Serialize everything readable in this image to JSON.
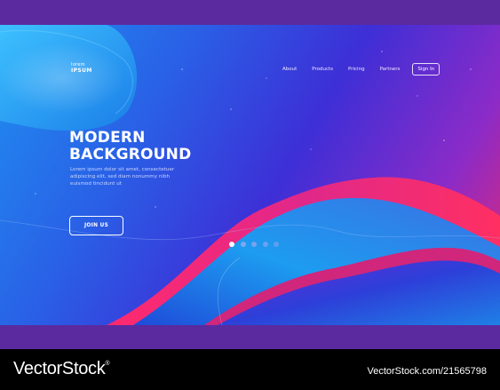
{
  "logo": {
    "line1": "lorem",
    "line2": "IPSUM"
  },
  "nav": {
    "items": [
      "About",
      "Products",
      "Pricing",
      "Partners"
    ],
    "signin": "Sign In"
  },
  "hero": {
    "headline": [
      "MODERN",
      "BACKGROUND"
    ],
    "body": [
      "Lorem ipsum dolor sit amet, consectetuer",
      "adipiscing elit, sed diam nonummy nibh",
      "euismod tincidunt ut"
    ],
    "cta": "JOIN US"
  },
  "pagination": {
    "count": 5,
    "active": 1
  },
  "watermark": {
    "brand": "VectorStock",
    "registered": "®",
    "site": "VectorStock.com/21565798"
  },
  "colors": {
    "frame": "#5b2a9e",
    "gradient_left": "#1f8ff0",
    "gradient_right": "#e6286e",
    "dot_active": "#ffffff",
    "dot_inactive": "#9aa6f0"
  }
}
